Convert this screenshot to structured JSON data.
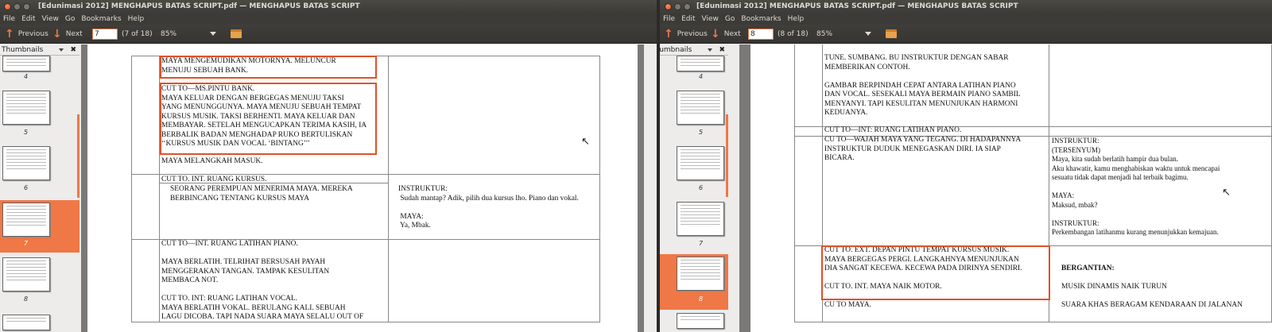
{
  "left": {
    "title": "[Edunimasi 2012] MENGHAPUS BATAS SCRIPT.pdf — MENGHAPUS BATAS SCRIPT",
    "menu": [
      "File",
      "Edit",
      "View",
      "Go",
      "Bookmarks",
      "Help"
    ],
    "previous_label": "Previous",
    "next_label": "Next",
    "page_value": "7",
    "page_info": "(7 of 18)",
    "zoom": "85%",
    "sidebar_title": "Thumbnails",
    "thumb_numbers": [
      "4",
      "5",
      "6",
      "7",
      "8"
    ],
    "text": {
      "r1": "MAYA MENGEMUDIKAN MOTORNYA. MELUNCUR\nMENUJU SEBUAH BANK.",
      "r2": "CUT TO—MS.PINTU BANK.\nMAYA KELUAR DENGAN BERGEGAS MENUJU TAKSI\nYANG MENUNGGUNYA. MAYA MENUJU SEBUAH TEMPAT\nKURSUS MUSIK. TAKSI BERHENTI. MAYA KELUAR DAN\nMEMBAYAR. SETELAH MENGUCAPKAN TERIMA KASIH, IA\nBERBALIK BADAN MENGHADAP RUKO BERTULISKAN\n‘‘KURSUS MUSIK DAN VOCAL ‘BINTANG’’’",
      "r3": "MAYA MELANGKAH MASUK.",
      "r4": "CUT TO. INT. RUANG KURSUS.",
      "r5": "SEORANG PEREMPUAN MENERIMA MAYA. MEREKA\nBERBINCANG TENTANG KURSUS MAYA",
      "r5b": "INSTRUKTUR:\n Sudah mantap? Adik, pilih dua kursus lho. Piano dan vokal.\n\n MAYA:\n Ya, Mbak.",
      "r6": "CUT TO—INT. RUANG LATIHAN PIANO.\n\nMAYA BERLATIH. TELRIHAT BERSUSAH PAYAH\nMENGGERAKAN TANGAN. TAMPAK KESULITAN\nMEMBACA NOT.\n\nCUT TO. INT: RUANG LATIHAN VOCAL.\nMAYA BERLATIH VOKAL. BERULANG KALI. SEBUAH\nLAGU DICOBA. TAPI NADA SUARA MAYA SELALU OUT OF"
    }
  },
  "right": {
    "title": "[Edunimasi 2012] MENGHAPUS BATAS SCRIPT.pdf — MENGHAPUS BATAS SCRIPT",
    "menu": [
      "File",
      "Edit",
      "View",
      "Go",
      "Bookmarks",
      "Help"
    ],
    "previous_label": "Previous",
    "next_label": "Next",
    "page_value": "8",
    "page_info": "(8 of 18)",
    "zoom": "85%",
    "sidebar_title": "Thumbnails",
    "thumb_numbers": [
      "4",
      "5",
      "6",
      "7",
      "8"
    ],
    "text": {
      "r1": "TUNE. SUMBANG. BU INSTRUKTUR DENGAN SABAR\nMEMBERIKAN CONTOH.\n\nGAMBAR BERPINDAH CEPAT ANTARA LATIHAN PIANO\nDAN VOCAL. SESEKALI MAYA BERMAIN PIANO SAMBIL\nMENYANYI. TAPI KESULITAN MENUNJUKAN HARMONI\nKEDUANYA.",
      "r2": "CUT TO—INT: RUANG LATIHAN PIANO.",
      "r3": "CU TO—WAJAH MAYA YANG TEGANG. DI HADAPANNYA\nINSTRUKTUR DUDUK MENEGASKAN DIRI. IA SIAP\nBICARA.",
      "r3b": "INSTRUKTUR:\n(TERSENYUM)\nMaya, kita sudah berlatih hampir dua bulan.\nAku khawatir, kamu menghabiskan waktu untuk mencapai\nsesuatu tidak dapat menjadi hal terbaik bagimu.\n\nMAYA:\nMaksud, mbak?\n\nINSTRUKTUR:\nPerkembangan latihanmu kurang menunjukkan kemajuan.",
      "r4": "CUT TO. EXT. DEPAN PINTU TEMPAT KURSUS MUSIK.\nMAYA BERGEGAS PERGI. LANGKAHNYA MENUNJUKAN\nDIA SANGAT KECEWA. KECEWA PADA DIRINYA SENDIRI.\n\nCUT TO. INT. MAYA NAIK MOTOR.",
      "r4b": "BERGANTIAN:",
      "r4c": "MUSIK DINAMIS NAIK TURUN\n\nSUARA KHAS BERAGAM KENDARAAN DI JALANAN",
      "r5": "CU TO MAYA."
    }
  }
}
